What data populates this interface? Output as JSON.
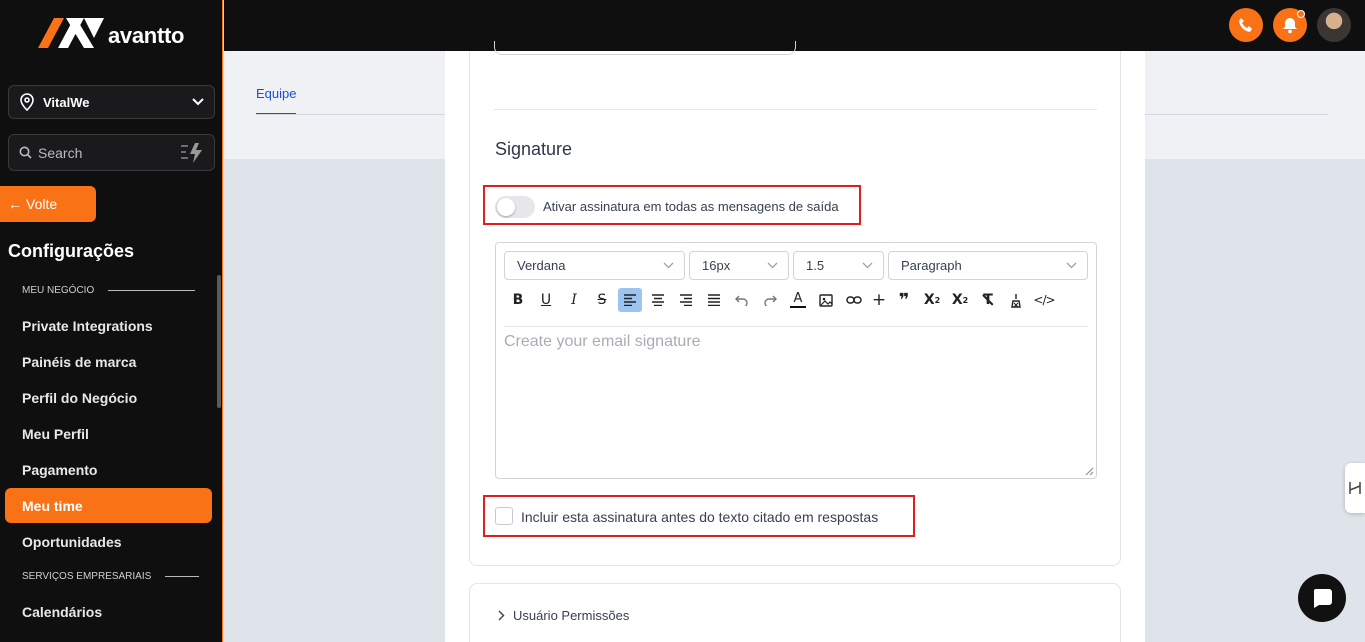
{
  "brand": {
    "name": "avantto",
    "accent": "#f97316"
  },
  "sidebar": {
    "location": "VitalWe",
    "search_placeholder": "Search",
    "back_label": "Volte",
    "title": "Configurações",
    "section_business": "MEU NEGÓCIO",
    "section_services": "SERVIÇOS EMPRESARIAIS",
    "items": [
      {
        "label": "Private Integrations"
      },
      {
        "label": "Painéis de marca"
      },
      {
        "label": "Perfil do Negócio"
      },
      {
        "label": "Meu Perfil"
      },
      {
        "label": "Pagamento"
      },
      {
        "label": "Meu time"
      },
      {
        "label": "Oportunidades"
      },
      {
        "label": "Calendários"
      }
    ]
  },
  "page": {
    "tab_label": "Equipe"
  },
  "signature": {
    "title": "Signature",
    "toggle_label": "Ativar assinatura em todas as mensagens de saída",
    "toggle_on": false,
    "font_family": "Verdana",
    "font_size": "16px",
    "line_height": "1.5",
    "block_type": "Paragraph",
    "editor_placeholder": "Create your email signature",
    "include_label": "Incluir esta assinatura antes do texto citado em respostas",
    "include_checked": false
  },
  "permissions": {
    "label": "Usuário Permissões"
  },
  "toolbar_icons": [
    "bold-icon",
    "underline-icon",
    "italic-icon",
    "strikethrough-icon",
    "align-left-icon",
    "align-center-icon",
    "align-right-icon",
    "align-justify-icon",
    "undo-icon",
    "redo-icon",
    "text-color-icon",
    "image-icon",
    "link-icon",
    "plus-icon",
    "quote-icon",
    "superscript-icon",
    "subscript-icon",
    "clear-format-icon",
    "clean-icon",
    "code-icon"
  ]
}
